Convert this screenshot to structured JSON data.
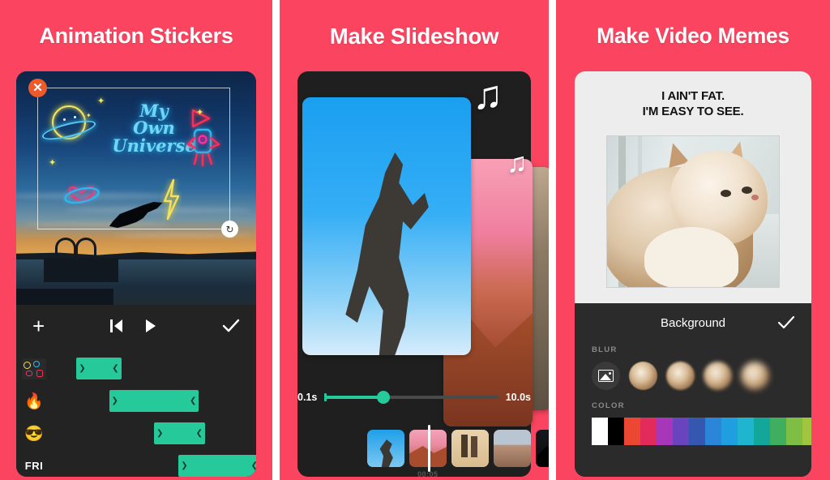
{
  "theme": {
    "background": "#fb4560",
    "accent_green": "#25c99a",
    "panel_dark": "#232323",
    "title_color": "#ffffff"
  },
  "panels": [
    {
      "title": "Animation Stickers",
      "editor": {
        "sticker_text_lines": [
          "My",
          "Own",
          "Universe"
        ],
        "selection": {
          "close_icon": "close-icon",
          "rotate_icon": "rotate-handle-icon"
        },
        "toolbar": [
          {
            "name": "add-button",
            "glyph": "+"
          },
          {
            "name": "prev-frame-button",
            "glyph": "⧏|"
          },
          {
            "name": "play-button",
            "glyph": "▶"
          },
          {
            "name": "confirm-button",
            "glyph": "✓"
          }
        ],
        "timeline_tracks": [
          {
            "label": "",
            "icon": "sticker-thumbnail-icon",
            "start_pct": 12,
            "width_pct": 22
          },
          {
            "label": "🔥",
            "icon": "fire-emoji-icon",
            "start_pct": 28,
            "width_pct": 44
          },
          {
            "label": "😎",
            "icon": "sunglasses-emoji-icon",
            "start_pct": 50,
            "width_pct": 25
          },
          {
            "label": "FRI",
            "icon": "text-label-icon",
            "start_pct": 62,
            "width_pct": 40
          }
        ]
      }
    },
    {
      "title": "Make Slideshow",
      "editor": {
        "music_notes": [
          "♫",
          "♫"
        ],
        "slider": {
          "min_label": "0.1s",
          "max_label": "10.0s",
          "value_pct": 34
        },
        "timestamp": "00:05",
        "thumbnails": [
          "slide-thumb-1",
          "slide-thumb-2",
          "slide-thumb-3",
          "slide-thumb-4",
          "slide-thumb-5"
        ]
      }
    },
    {
      "title": "Make Video Memes",
      "editor": {
        "meme_text_lines": [
          "I AIN'T FAT.",
          "I'M EASY TO SEE."
        ],
        "panel_title": "Background",
        "confirm_glyph": "✓",
        "sections": [
          {
            "label": "BLUR"
          },
          {
            "label": "COLOR"
          }
        ],
        "blur_options": [
          "no-blur-option",
          "blur-level-1",
          "blur-level-2",
          "blur-level-3",
          "blur-level-4"
        ],
        "color_swatches": [
          "#ffffff",
          "#000000",
          "#ec4733",
          "#e22a5b",
          "#a736b8",
          "#6a44bf",
          "#3657b0",
          "#2b86da",
          "#1f9fe0",
          "#1fb5cf",
          "#13a79c",
          "#3fae5e",
          "#7fbe45",
          "#9fc63e",
          "#f5365c"
        ],
        "selected_swatch_index": 0
      }
    }
  ]
}
